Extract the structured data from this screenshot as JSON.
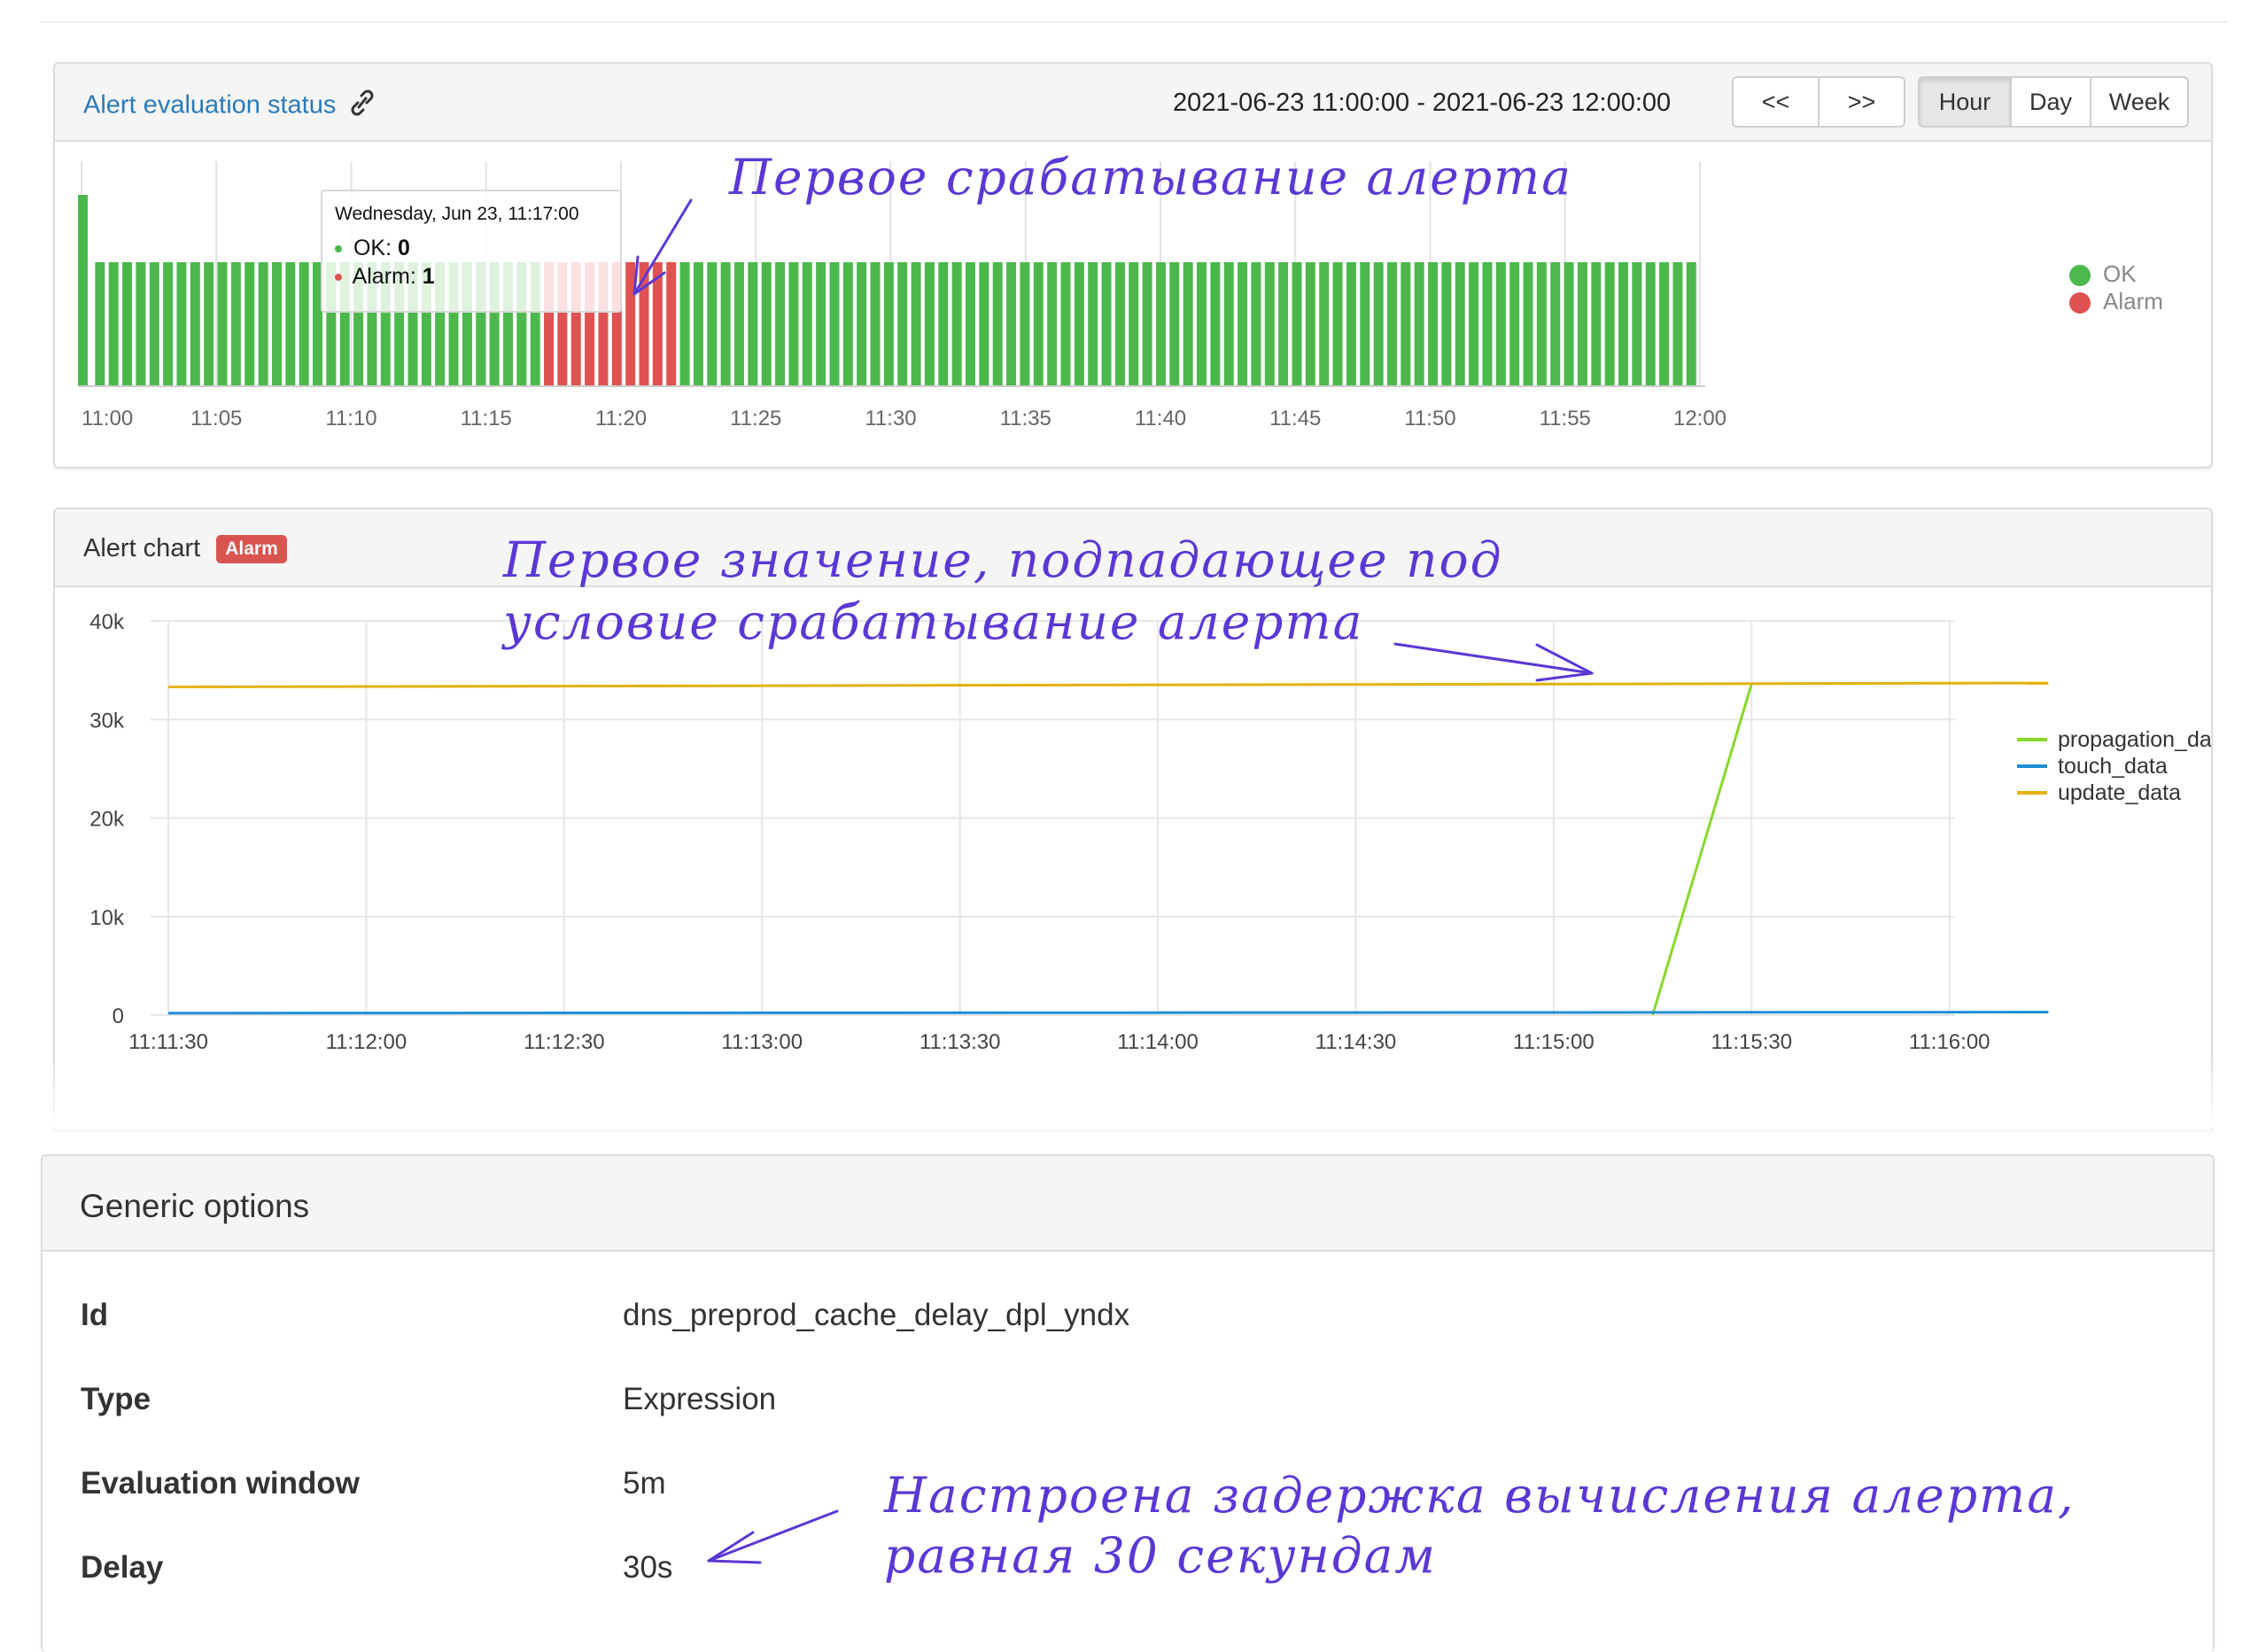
{
  "status_panel": {
    "title": "Alert evaluation status",
    "range": "2021-06-23 11:00:00 - 2021-06-23 12:00:00",
    "prev_label": "<<",
    "next_label": ">>",
    "periods": [
      "Hour",
      "Day",
      "Week"
    ],
    "active_period": "Hour",
    "tooltip": {
      "date": "Wednesday, Jun 23, 11:17:00",
      "ok_label": "OK:",
      "ok_value": "0",
      "alarm_label": "Alarm:",
      "alarm_value": "1"
    },
    "legend": [
      "OK",
      "Alarm"
    ],
    "colors": {
      "ok": "#4cb84c",
      "alarm": "#e05252",
      "link": "#2a7ab8"
    }
  },
  "alert_chart_panel": {
    "title": "Alert chart",
    "badge": "Alarm",
    "badge_color": "#d9534f"
  },
  "chart_data": [
    {
      "type": "bar",
      "x_ticks": [
        "11:00",
        "11:05",
        "11:10",
        "11:15",
        "11:20",
        "11:25",
        "11:30",
        "11:35",
        "11:40",
        "11:45",
        "11:50",
        "11:55",
        "12:00"
      ],
      "bar_count": 119,
      "first_bar_minute": 0,
      "last_bar_minute": 59.5,
      "alarm_start_minute": 17,
      "alarm_end_minute": 22,
      "series": [
        {
          "name": "OK"
        },
        {
          "name": "Alarm"
        }
      ],
      "first_bar_taller": true,
      "colors": [
        "#4cb84c",
        "#e05252"
      ]
    },
    {
      "type": "line",
      "x_ticks": [
        "11:11:30",
        "11:12:00",
        "11:12:30",
        "11:13:00",
        "11:13:30",
        "11:14:00",
        "11:14:30",
        "11:15:00",
        "11:15:30",
        "11:16:00"
      ],
      "y_ticks": [
        "0",
        "10k",
        "20k",
        "30k",
        "40k"
      ],
      "ylim": [
        0,
        40000
      ],
      "x_range_seconds": [
        0,
        285
      ],
      "series": [
        {
          "name": "propagation_data",
          "color": "#88d829",
          "points": [
            [
              225,
              0
            ],
            [
              240,
              33600
            ]
          ]
        },
        {
          "name": "touch_data",
          "color": "#1d8fd6",
          "points": [
            [
              0,
              200
            ],
            [
              285,
              300
            ]
          ]
        },
        {
          "name": "update_data",
          "color": "#e5b112",
          "points": [
            [
              0,
              33300
            ],
            [
              285,
              33700
            ]
          ]
        }
      ],
      "grid": true,
      "legend_position": "right"
    }
  ],
  "generic_options": {
    "title": "Generic options",
    "rows": [
      {
        "label": "Id",
        "value": "dns_preprod_cache_delay_dpl_yndx"
      },
      {
        "label": "Type",
        "value": "Expression"
      },
      {
        "label": "Evaluation window",
        "value": "5m"
      },
      {
        "label": "Delay",
        "value": "30s"
      }
    ]
  },
  "annotations": {
    "first_trigger": "Первое срабатывание алерта",
    "first_value_line1": "Первое значение, подпадающее под",
    "first_value_line2": "условие срабатывание алерта",
    "delay_line1": "Настроена задержка вычисления алерта,",
    "delay_line2": "равная 30 секундам",
    "color": "#5a38d4"
  }
}
